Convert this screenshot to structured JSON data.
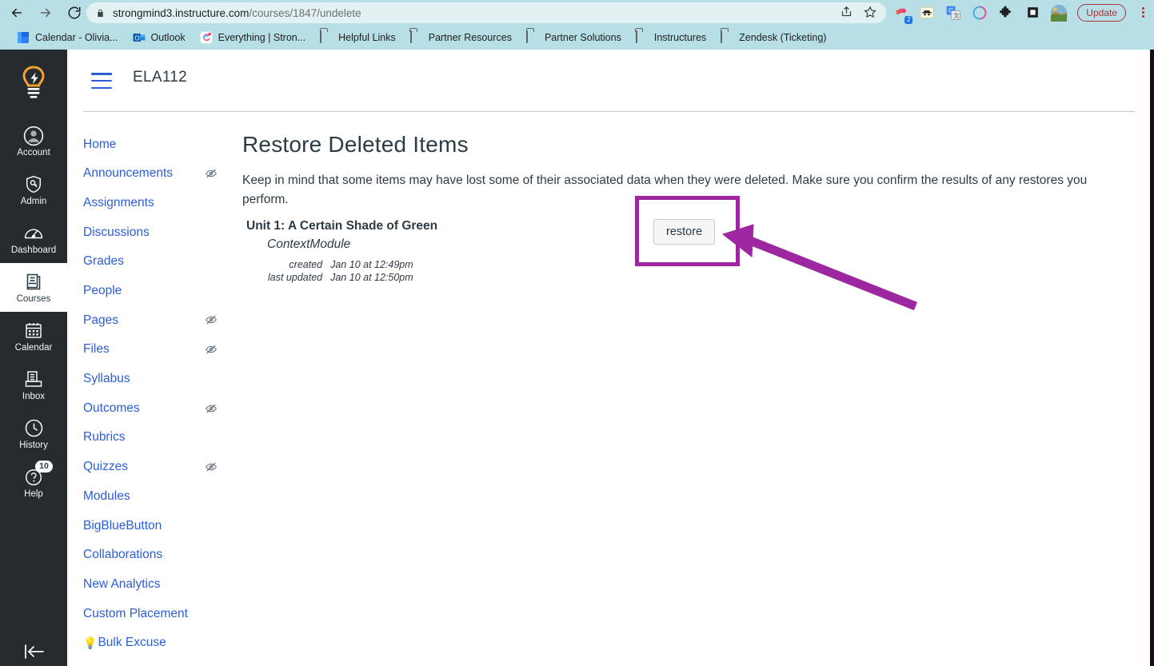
{
  "browser": {
    "nav": {
      "back_icon": "back-arrow-icon",
      "forward_icon": "forward-arrow-icon",
      "reload_icon": "reload-icon"
    },
    "omnibox": {
      "lock_icon": "lock-icon",
      "url_host": "strongmind3.instructure.com",
      "url_path": "/courses/1847/undelete",
      "full_url": "strongmind3.instructure.com/courses/1847/undelete",
      "share_icon": "share-icon",
      "bookmark_icon": "star-icon"
    },
    "toolbar": {
      "extension_badge_count": "2",
      "update_label": "Update",
      "menu_icon": "kebab-menu-icon",
      "icons": [
        "extension-puzzle-colored-icon",
        "detective-icon",
        "google-translate-icon",
        "loom-record-icon",
        "puzzle-extensions-icon",
        "reading-mode-icon",
        "profile-avatar-icon"
      ]
    },
    "bookmarks": [
      {
        "label": "Calendar - Olivia...",
        "icon": "calendar-favicon"
      },
      {
        "label": "Outlook",
        "icon": "outlook-favicon"
      },
      {
        "label": "Everything | Stron...",
        "icon": "everything-favicon"
      },
      {
        "label": "Helpful Links",
        "icon": "folder-icon"
      },
      {
        "label": "Partner Resources",
        "icon": "folder-icon"
      },
      {
        "label": "Partner Solutions",
        "icon": "folder-icon"
      },
      {
        "label": "Instructures",
        "icon": "folder-icon"
      },
      {
        "label": "Zendesk (Ticketing)",
        "icon": "folder-icon"
      }
    ]
  },
  "global_nav": {
    "logo_icon": "canvas-lightbulb-logo",
    "collapse_icon": "collapse-arrow-icon",
    "items": [
      {
        "label": "Account",
        "icon": "account-avatar-icon",
        "active": false
      },
      {
        "label": "Admin",
        "icon": "shield-key-icon",
        "active": false
      },
      {
        "label": "Dashboard",
        "icon": "dashboard-gauge-icon",
        "active": false
      },
      {
        "label": "Courses",
        "icon": "courses-book-icon",
        "active": true
      },
      {
        "label": "Calendar",
        "icon": "calendar-icon",
        "active": false
      },
      {
        "label": "Inbox",
        "icon": "inbox-tray-icon",
        "active": false
      },
      {
        "label": "History",
        "icon": "clock-history-icon",
        "active": false
      },
      {
        "label": "Help",
        "icon": "help-question-icon",
        "active": false,
        "badge": "10"
      }
    ]
  },
  "course_header": {
    "menu_icon": "hamburger-menu-icon",
    "title": "ELA112"
  },
  "course_nav": {
    "items": [
      {
        "label": "Home",
        "hidden": false
      },
      {
        "label": "Announcements",
        "hidden": true
      },
      {
        "label": "Assignments",
        "hidden": false
      },
      {
        "label": "Discussions",
        "hidden": false
      },
      {
        "label": "Grades",
        "hidden": false
      },
      {
        "label": "People",
        "hidden": false
      },
      {
        "label": "Pages",
        "hidden": true
      },
      {
        "label": "Files",
        "hidden": true
      },
      {
        "label": "Syllabus",
        "hidden": false
      },
      {
        "label": "Outcomes",
        "hidden": true
      },
      {
        "label": "Rubrics",
        "hidden": false
      },
      {
        "label": "Quizzes",
        "hidden": true
      },
      {
        "label": "Modules",
        "hidden": false
      },
      {
        "label": "BigBlueButton",
        "hidden": false
      },
      {
        "label": "Collaborations",
        "hidden": false
      },
      {
        "label": "New Analytics",
        "hidden": false
      },
      {
        "label": "Custom Placement",
        "hidden": false
      },
      {
        "label": "Bulk Excuse",
        "hidden": false,
        "emoji": "💡"
      }
    ],
    "hidden_icon": "eye-slash-icon"
  },
  "main": {
    "page_title": "Restore Deleted Items",
    "intro": "Keep in mind that some items may have lost some of their associated data when they were deleted. Make sure you confirm the results of any restores you perform.",
    "deleted_item": {
      "name": "Unit 1: A Certain Shade of Green",
      "type": "ContextModule",
      "meta": [
        {
          "key": "created",
          "value": "Jan 10 at 12:49pm"
        },
        {
          "key": "last updated",
          "value": "Jan 10 at 12:50pm"
        }
      ],
      "restore_label": "restore"
    }
  },
  "annotation": {
    "color": "#9c27a0",
    "highlight_target": "restore-button",
    "arrow_icon": "annotation-arrow-icon"
  },
  "colors": {
    "browser_chrome": "#b7dfe5",
    "omnibox": "#e2f2f3",
    "canvas_nav_bg": "#262b30",
    "link_blue": "#2b5ed6",
    "text_dark": "#2d3b45",
    "annotation_purple": "#9c27a0",
    "update_red": "#aa3333"
  }
}
